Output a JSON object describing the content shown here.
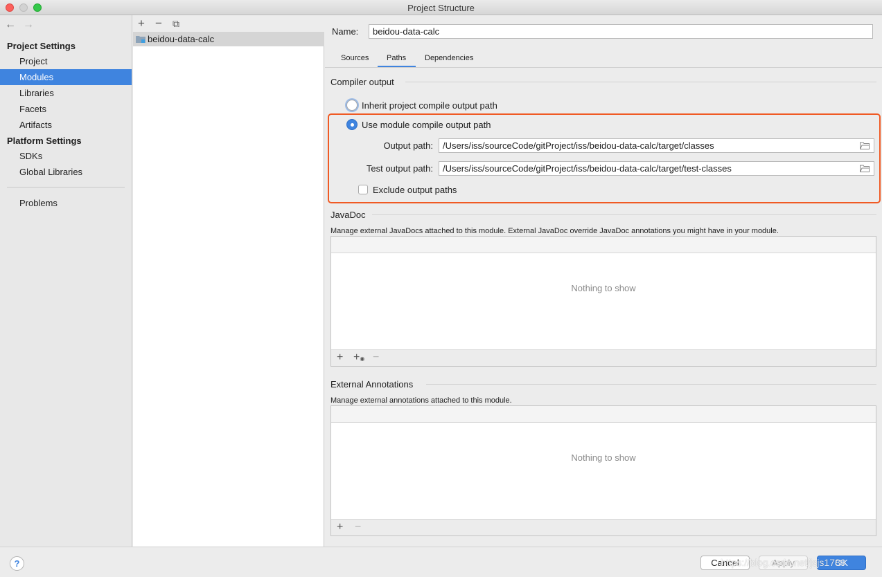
{
  "window": {
    "title": "Project Structure"
  },
  "sidebar": {
    "sections": [
      {
        "title": "Project Settings",
        "items": [
          "Project",
          "Modules",
          "Libraries",
          "Facets",
          "Artifacts"
        ]
      },
      {
        "title": "Platform Settings",
        "items": [
          "SDKs",
          "Global Libraries"
        ]
      }
    ],
    "bottom_item": "Problems",
    "selected": "Modules"
  },
  "modules": {
    "items": [
      "beidou-data-calc"
    ],
    "selected": "beidou-data-calc"
  },
  "detail": {
    "name_label": "Name:",
    "name_value": "beidou-data-calc",
    "tabs": [
      "Sources",
      "Paths",
      "Dependencies"
    ],
    "active_tab": "Paths",
    "compiler_output": {
      "title": "Compiler output",
      "inherit_label": "Inherit project compile output path",
      "use_module_label": "Use module compile output path",
      "selected_option": "use_module",
      "output_path_label": "Output path:",
      "output_path_value": "/Users/iss/sourceCode/gitProject/iss/beidou-data-calc/target/classes",
      "test_output_path_label": "Test output path:",
      "test_output_path_value": "/Users/iss/sourceCode/gitProject/iss/beidou-data-calc/target/test-classes",
      "exclude_label": "Exclude output paths",
      "exclude_checked": false
    },
    "javadoc": {
      "title": "JavaDoc",
      "description": "Manage external JavaDocs attached to this module. External JavaDoc override JavaDoc annotations you might have in your module.",
      "empty_text": "Nothing to show"
    },
    "external_annotations": {
      "title": "External Annotations",
      "description": "Manage external annotations attached to this module.",
      "empty_text": "Nothing to show"
    }
  },
  "footer": {
    "help_label": "?",
    "cancel_label": "Cancel",
    "apply_label": "Apply",
    "ok_label": "OK",
    "watermark": "https://blog.csdn.net/jsjs1789"
  },
  "colors": {
    "accent": "#3f84df",
    "highlight_border": "#f05a24",
    "sidebar_bg": "#e8e8e8",
    "window_bg": "#ececec"
  }
}
